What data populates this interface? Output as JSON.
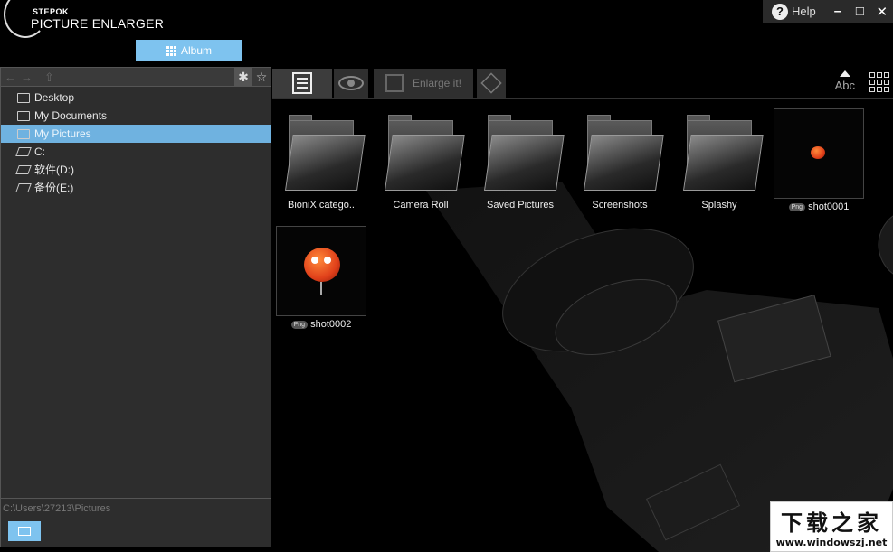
{
  "app": {
    "brand": "STEPOK",
    "title": "PICTURE ENLARGER"
  },
  "window": {
    "help_label": "Help",
    "minimize": "–",
    "maximize": "□",
    "close": "✕"
  },
  "album_tab": {
    "label": "Album"
  },
  "left_toolbar": {
    "back": "←",
    "forward": "→",
    "up": "⇧",
    "new_folder": "✱",
    "favorite": "☆"
  },
  "tree": [
    {
      "label": "Desktop",
      "icon": "desktop-icon"
    },
    {
      "label": "My Documents",
      "icon": "folder-icon"
    },
    {
      "label": "My Pictures",
      "icon": "pictures-icon",
      "selected": true
    },
    {
      "label": "C:",
      "icon": "drive-icon"
    },
    {
      "label": "软件(D:)",
      "icon": "drive-icon"
    },
    {
      "label": "备份(E:)",
      "icon": "drive-icon"
    }
  ],
  "path": "C:\\Users\\27213\\Pictures",
  "toolbar": {
    "enlarge_label": "Enlarge it!",
    "sort_label": "Abc"
  },
  "items": [
    {
      "label": "BioniX catego..",
      "type": "folder"
    },
    {
      "label": "Camera Roll",
      "type": "folder"
    },
    {
      "label": "Saved Pictures",
      "type": "folder"
    },
    {
      "label": "Screenshots",
      "type": "folder"
    },
    {
      "label": "Splashy",
      "type": "folder"
    },
    {
      "label": "shot0001",
      "type": "png",
      "badge": "Png"
    },
    {
      "label": "shot0002",
      "type": "png",
      "badge": "Png"
    }
  ],
  "watermark": {
    "cn": "下载之家",
    "url": "www.windowszj.net"
  },
  "colors": {
    "accent": "#7ec3ef",
    "selected": "#6fb2e0",
    "panel": "#2d2d2d"
  }
}
